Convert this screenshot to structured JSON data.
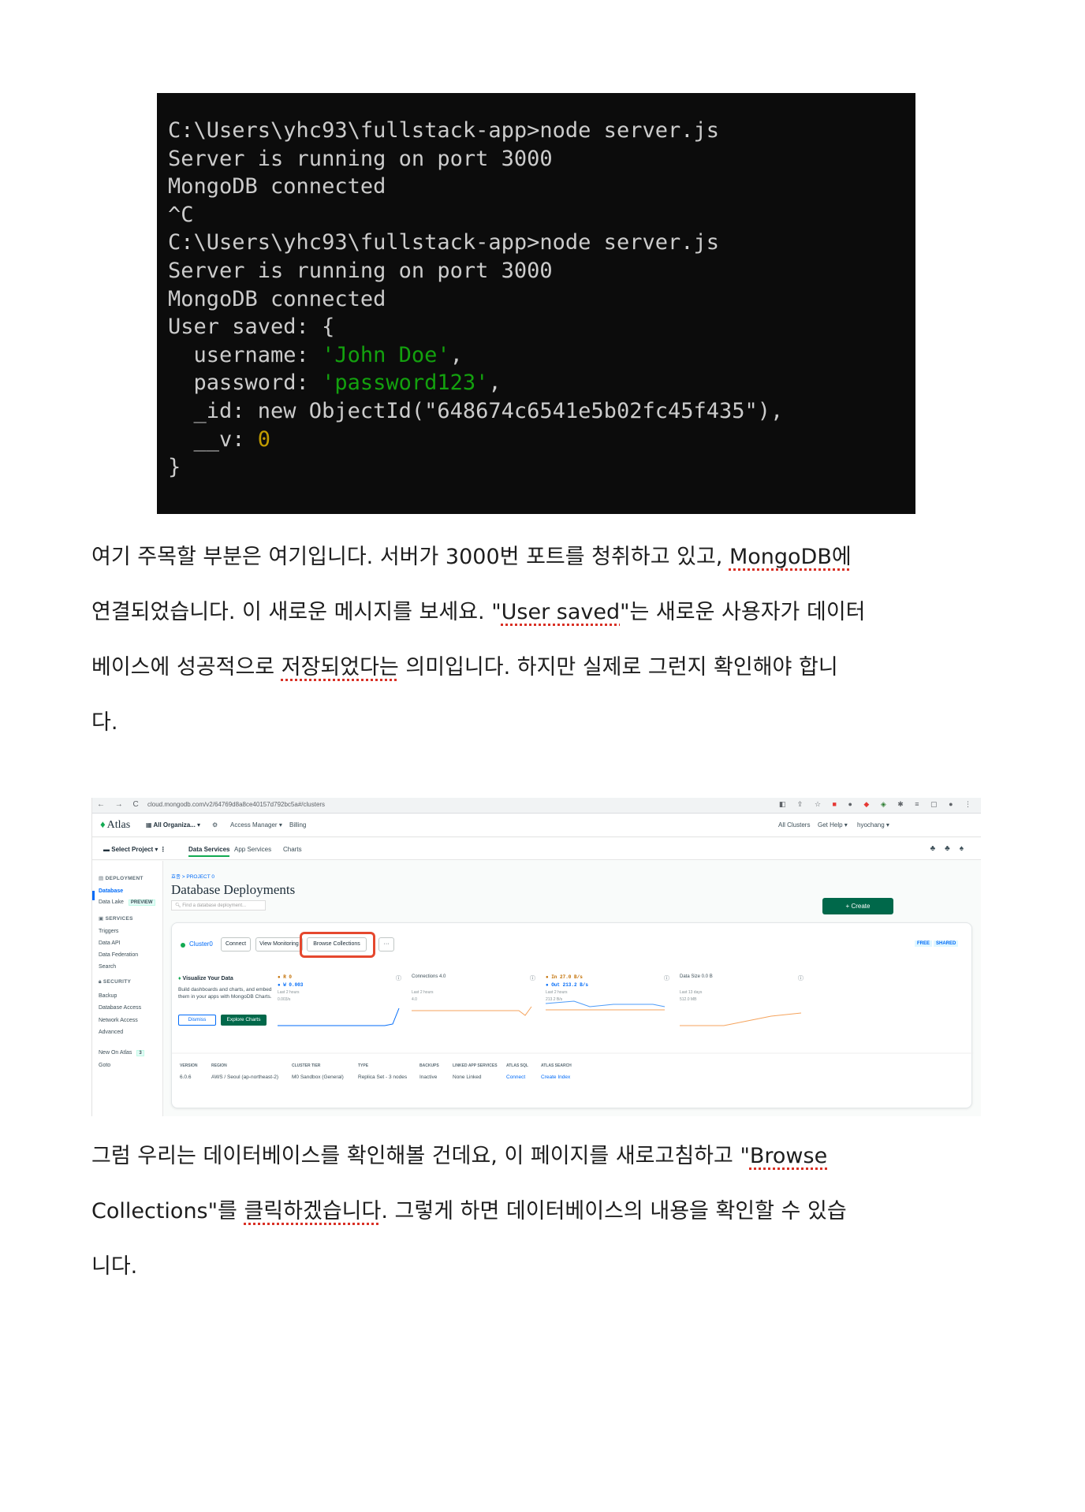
{
  "terminal": {
    "lines": [
      "C:\\Users\\yhc93\\fullstack-app>node server.js",
      "Server is running on port 3000",
      "MongoDB connected",
      "^C",
      "C:\\Users\\yhc93\\fullstack-app>node server.js",
      "Server is running on port 3000",
      "MongoDB connected",
      "User saved: {"
    ],
    "username_key": "  username: ",
    "username_val": "'John Doe'",
    "password_key": "  password: ",
    "password_val": "'password123'",
    "id_line": "  _id: new ObjectId(\"648674c6541e5b02fc45f435\"),",
    "v_key": "  __v: ",
    "v_val": "0",
    "close": "}",
    "comma": ","
  },
  "paragraph1": {
    "p1": "여기 주목할 부분은 여기입니다. 서버가 3000번 포트를 청취하고 있고, ",
    "p1_sq": "MongoDB에",
    "p2": "연결되었습니다. 이 새로운 메시지를 보세요. \"",
    "p2_sq": "User saved",
    "p3": "\"는 새로운 사용자가 데이터",
    "p4": "베이스에 성공적으로 ",
    "p4_sq": "저장되었다는",
    "p5": " 의미입니다. 하지만 실제로 그런지 확인해야 합니",
    "p6": "다."
  },
  "paragraph2": {
    "p1": "그럼 우리는 데이터베이스를 확인해볼 건데요, 이 페이지를 새로고침하고 \"",
    "p1_sq": "Browse",
    "p2": "Collections\"를 ",
    "p2_sq": "클릭하겠습니다",
    "p3": ". 그렇게 하면 데이터베이스의 내용을 확인할 수 있습",
    "p4": "니다."
  },
  "atlas": {
    "browser": {
      "nav": "← → C",
      "url": "cloud.mongodb.com/v2/64769d8a8ce40157d792bc5a#/clusters"
    },
    "topbar": {
      "logo": "Atlas",
      "org": "All Organiza...",
      "access": "Access Manager",
      "billing": "Billing",
      "all_clusters": "All Clusters",
      "help": "Get Help",
      "user": "hyochang"
    },
    "projbar": {
      "project": "Select Project",
      "data_services": "Data Services",
      "app_services": "App Services",
      "charts": "Charts"
    },
    "sidebar": {
      "deployment": "DEPLOYMENT",
      "database": "Database",
      "data_lake": "Data Lake",
      "preview": "PREVIEW",
      "services": "SERVICES",
      "triggers": "Triggers",
      "data_api": "Data API",
      "data_federation": "Data Federation",
      "search": "Search",
      "security": "SECURITY",
      "backup": "Backup",
      "db_access": "Database Access",
      "net_access": "Network Access",
      "advanced": "Advanced",
      "new_on_atlas": "New On Atlas",
      "new_count": "3",
      "goto": "Goto"
    },
    "main": {
      "breadcrumb": "효종 > PROJECT 0",
      "title": "Database Deployments",
      "search_placeholder": "Find a database deployment...",
      "create": "+ Create"
    },
    "cluster": {
      "name": "Cluster0",
      "connect": "Connect",
      "view_monitoring": "View Monitoring",
      "browse_collections": "Browse Collections",
      "more": "···",
      "free": "FREE",
      "shared": "SHARED",
      "viz_title": "Visualize Your Data",
      "viz_text": "Build dashboards and charts, and embed them in your apps with MongoDB Charts.",
      "dismiss": "Dismiss",
      "explore": "Explore Charts",
      "m1_a": "● R  0",
      "m1_b": "● W  0.003",
      "m1_sub": "Last 2 hours",
      "m1_axis": "0.003/s",
      "m2_a": "Connections  4.0",
      "m2_sub": "Last 2 hours",
      "m2_axis": "4.0",
      "m3_a": "● In  27.0 B/s",
      "m3_b": "● Out  213.2 B/s",
      "m3_sub": "Last 2 hours",
      "m3_axis": "213.2 B/s",
      "m4_a": "Data Size  0.0 B",
      "m4_sub": "Last 13 days",
      "m4_axis": "512.0 MB",
      "details_headers": [
        "VERSION",
        "REGION",
        "CLUSTER TIER",
        "TYPE",
        "BACKUPS",
        "LINKED APP SERVICES",
        "ATLAS SQL",
        "ATLAS SEARCH"
      ],
      "details_values": [
        "6.0.6",
        "AWS / Seoul (ap-northeast-2)",
        "M0 Sandbox (General)",
        "Replica Set - 3 nodes",
        "Inactive",
        "None Linked",
        "Connect",
        "Create Index"
      ]
    }
  }
}
